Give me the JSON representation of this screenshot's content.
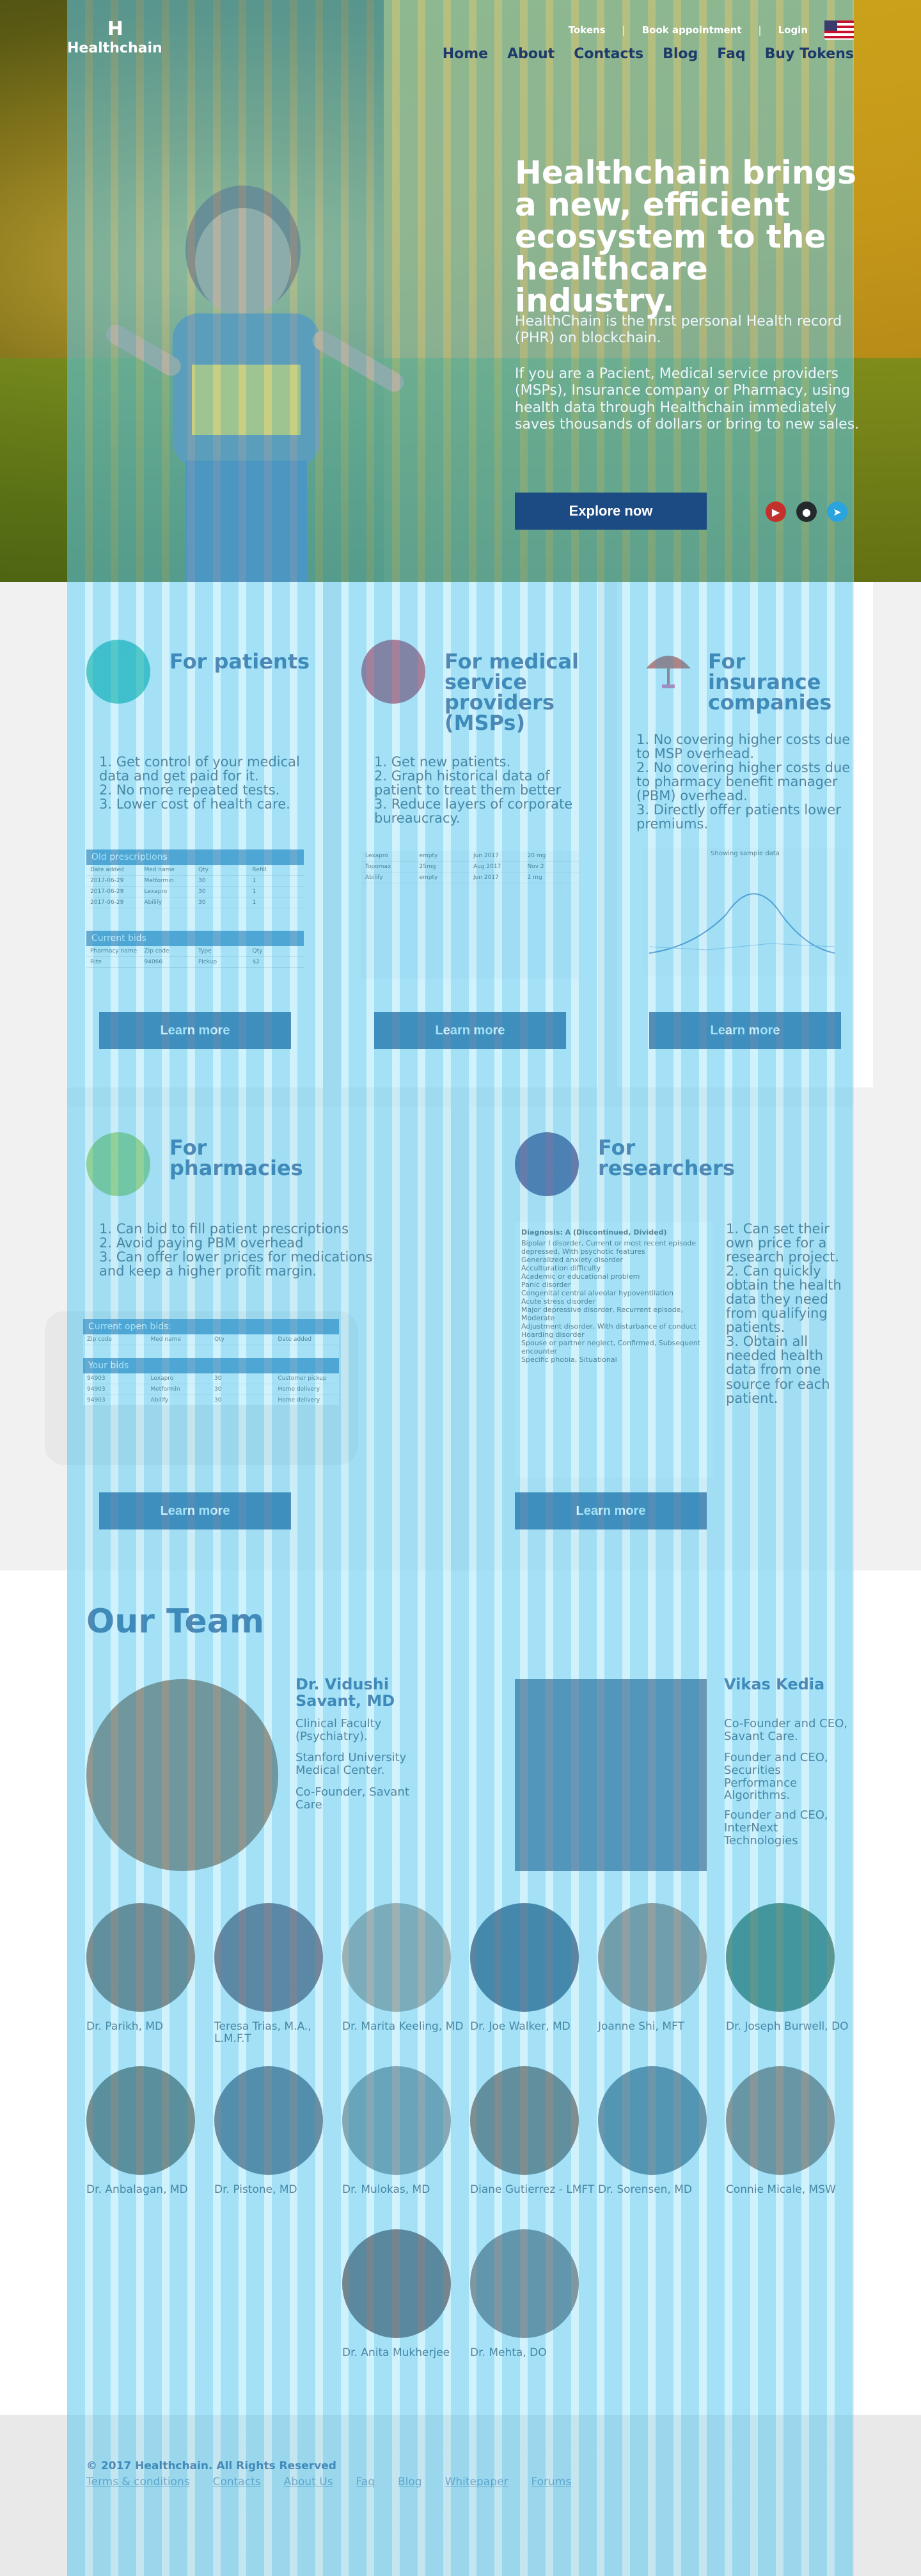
{
  "header": {
    "logo_name": "Healthchain",
    "top_links": [
      "Tokens",
      "Book appointment",
      "Login"
    ],
    "nav": [
      "Home",
      "About",
      "Contacts",
      "Blog",
      "Faq",
      "Buy Tokens"
    ]
  },
  "hero": {
    "title": "Healthchain brings a new, efficient ecosystem to the healthcare industry.",
    "p1": "HealthChain is the first personal Health record (PHR) on blockchain.",
    "p2": "If you are a Pacient, Medical service providers (MSPs), Insurance company or Pharmacy, using health data through Healthchain immediately saves thousands of dollars or bring to new sales.",
    "cta": "Explore now"
  },
  "sections": {
    "patients": {
      "title": "For patients",
      "items": [
        "1. Get control of your medical data and get paid for it.",
        "2. No more repeated tests.",
        "3. Lower cost of health care."
      ],
      "table1_head": "Old prescriptions",
      "table2_head": "Current bids",
      "cta": "Learn more"
    },
    "msps": {
      "title": "For medical service providers (MSPs)",
      "items": [
        "1. Get new patients.",
        "2. Graph historical data of patient to treat them better",
        "3. Reduce layers of corporate bureaucracy."
      ],
      "cta": "Learn more"
    },
    "insurance": {
      "title": "For insurance companies",
      "items": [
        "1. No covering higher costs due to MSP overhead.",
        "2. No covering higher costs due to pharmacy benefit manager (PBM) overhead.",
        "3. Directly offer patients lower premiums."
      ],
      "chart_title": "Showing sample data",
      "cta": "Learn more"
    },
    "pharmacies": {
      "title": "For pharmacies",
      "items": [
        "1. Can bid to fill patient prescriptions",
        "2. Avoid paying PBM overhead",
        "3. Can offer lower prices for medications and keep a higher profit margin."
      ],
      "table1_head": "Current open bids:",
      "table2_head": "Your bids",
      "cta": "Learn more"
    },
    "researchers": {
      "title": "For researchers",
      "items": [
        "1. Can set their own price for a research project.",
        "2. Can quickly obtain the health data they need from qualifying patients.",
        "3. Obtain all needed health data from one source for each patient."
      ],
      "diag_title": "Diagnosis: A (Discontinued, Divided)",
      "diag_items": [
        "Bipolar I disorder, Current or most recent episode depressed, With psychotic features",
        "Generalized anxiety disorder",
        "Acculturation difficulty",
        "Academic or educational problem",
        "Panic disorder",
        "Congenital central alveolar hypoventilation",
        "Acute stress disorder",
        "Major depressive disorder, Recurrent episode, Moderate",
        "Adjustment disorder, With disturbance of conduct",
        "Hoarding disorder",
        "Spouse or partner neglect, Confirmed, Subsequent encounter",
        "Specific phobia, Situational"
      ],
      "cta": "Learn more"
    }
  },
  "team": {
    "title": "Our Team",
    "leads": [
      {
        "name": "Dr. Vidushi Savant, MD",
        "lines": [
          "Clinical Faculty (Psychiatry).",
          "Stanford University Medical Center.",
          "Co-Founder, Savant Care"
        ]
      },
      {
        "name": "Vikas Kedia",
        "lines": [
          "Co-Founder and CEO, Savant Care.",
          "Founder and CEO, Securities Performance Algorithms.",
          "Founder and CEO, InterNext Technologies"
        ]
      }
    ],
    "members": [
      "Dr. Parikh, MD",
      "Teresa Trias, M.A., L.M.F.T",
      "Dr. Marita Keeling, MD",
      "Dr. Joe Walker, MD",
      "Joanne Shi, MFT",
      "Dr. Joseph Burwell, DO",
      "Dr. Anbalagan, MD",
      "Dr. Pistone, MD",
      "Dr. Mulokas, MD",
      "Diane Gutierrez - LMFT",
      "Dr. Sorensen, MD",
      "Connie Micale, MSW",
      "Dr. Anita Mukherjee",
      "Dr. Mehta, DO"
    ]
  },
  "footer": {
    "copyright": "© 2017 Healthchain. All Rights Reserved",
    "links": [
      "Terms & conditions",
      "Contacts",
      "About Us",
      "Faq",
      "Blog",
      "Whitepaper",
      "Forums"
    ]
  },
  "colors": {
    "accent": "#1c4a82",
    "title": "#1b4079",
    "overlay": "#5ac8f0"
  }
}
